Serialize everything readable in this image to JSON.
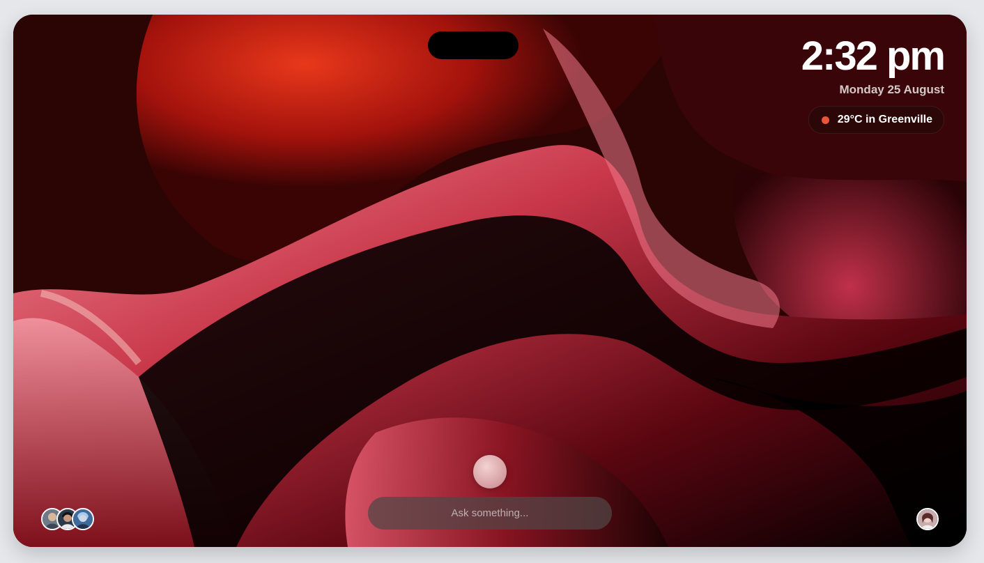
{
  "clock": {
    "time": "2:32 pm",
    "date": "Monday 25 August"
  },
  "weather": {
    "label": "29°C in Greenville",
    "dot_color": "#e8553b"
  },
  "assistant": {
    "input_placeholder": "Ask something..."
  },
  "participants": {
    "avatars": [
      "avatar-1",
      "avatar-2",
      "avatar-3"
    ]
  },
  "theme": {
    "wallpaper_primary": "#c8202b",
    "wallpaper_highlight": "#e86a7a",
    "wallpaper_dark": "#1a0303"
  }
}
